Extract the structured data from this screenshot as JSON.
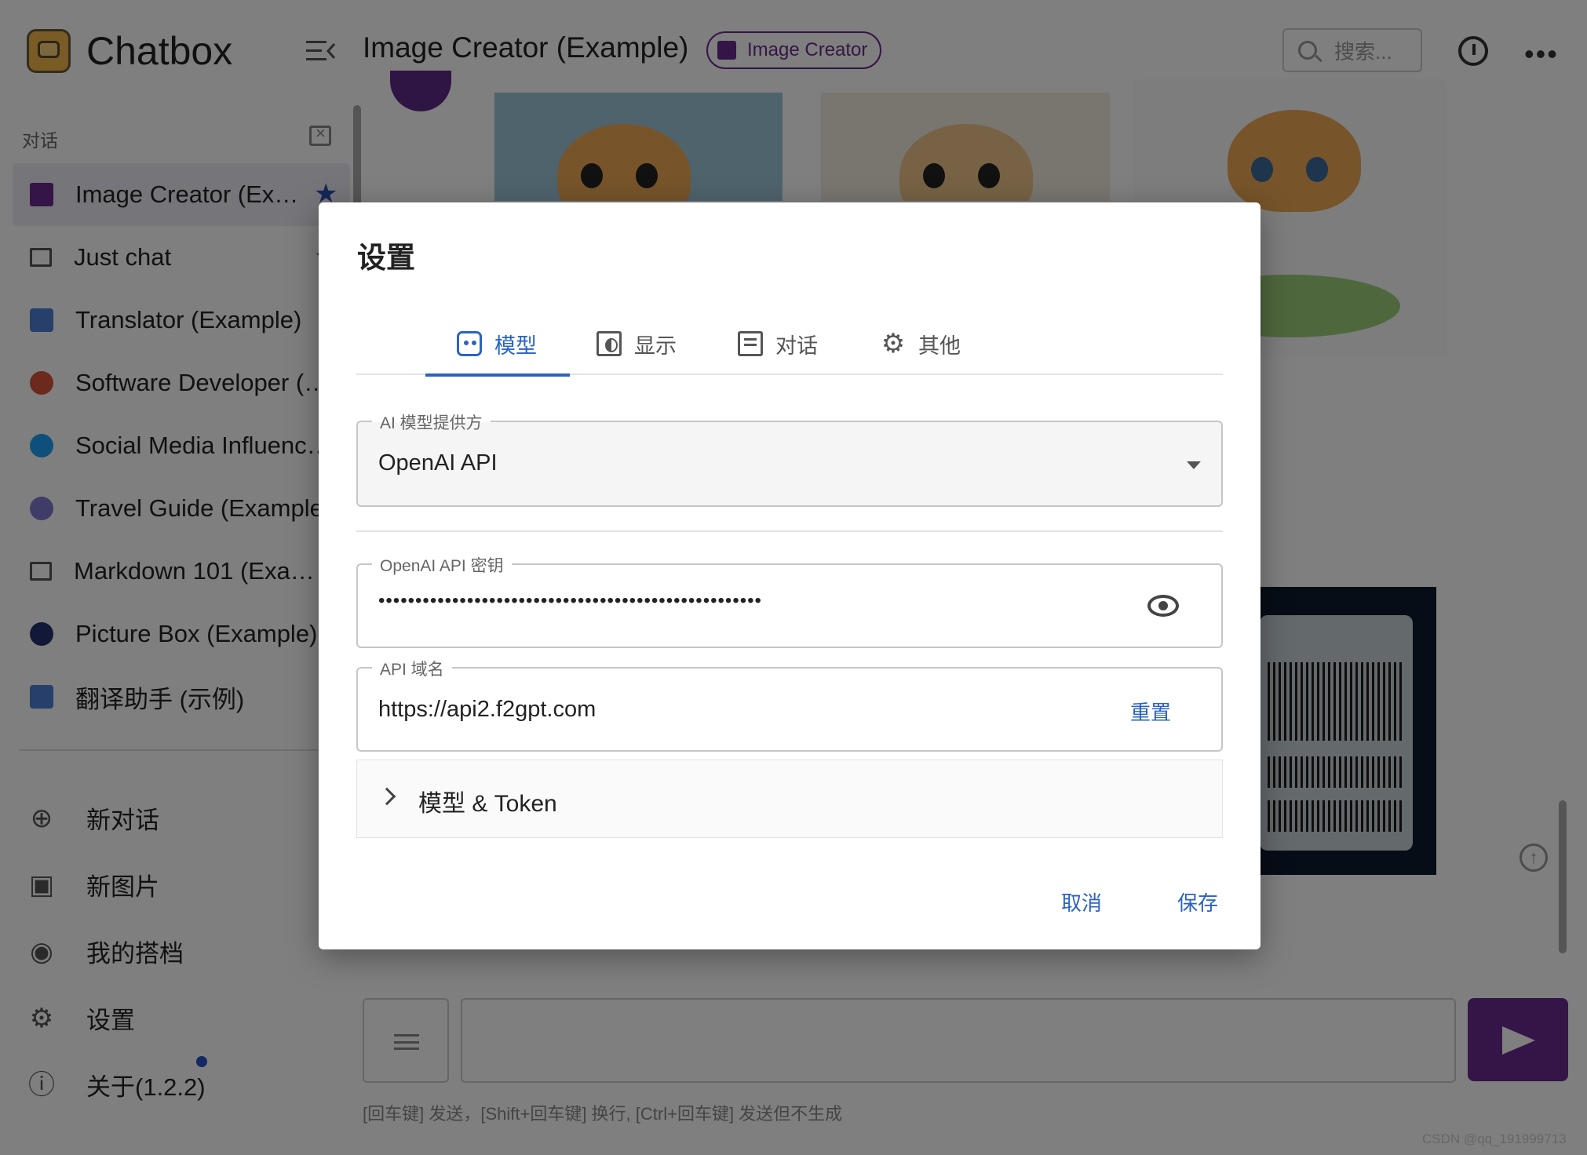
{
  "app": {
    "name": "Chatbox",
    "colors": {
      "accent": "#6b2a8e",
      "primary": "#2a63c6"
    }
  },
  "sidebar": {
    "section_label": "对话",
    "conversations": [
      {
        "label": "Image Creator (Ex…",
        "icon": "image-icon",
        "starred": true,
        "active": true
      },
      {
        "label": "Just chat",
        "icon": "chat-bubble-icon",
        "starred": true,
        "active": false
      },
      {
        "label": "Translator (Example)",
        "icon": "translator-avatar-icon",
        "starred": false,
        "active": false
      },
      {
        "label": "Software Developer (…",
        "icon": "developer-avatar-icon",
        "starred": false,
        "active": false
      },
      {
        "label": "Social Media Influenc…",
        "icon": "twitter-avatar-icon",
        "starred": false,
        "active": false
      },
      {
        "label": "Travel Guide (Example)",
        "icon": "travel-avatar-icon",
        "starred": false,
        "active": false
      },
      {
        "label": "Markdown 101 (Exa…",
        "icon": "chat-bubble-icon",
        "starred": false,
        "active": false
      },
      {
        "label": "Picture Box (Example)",
        "icon": "picture-avatar-icon",
        "starred": false,
        "active": false
      },
      {
        "label": "翻译助手 (示例)",
        "icon": "translator-avatar-icon",
        "starred": false,
        "active": false
      }
    ],
    "actions": [
      {
        "label": "新对话",
        "icon": "plus-circle-icon"
      },
      {
        "label": "新图片",
        "icon": "add-image-icon"
      },
      {
        "label": "我的搭档",
        "icon": "robot-icon"
      },
      {
        "label": "设置",
        "icon": "gear-icon"
      },
      {
        "label": "关于(1.2.2)",
        "icon": "info-icon"
      }
    ]
  },
  "header": {
    "title": "Image Creator (Example)",
    "chip": "Image Creator",
    "search_placeholder": "搜索..."
  },
  "composer": {
    "hint": "[回车键] 发送，[Shift+回车键] 换行, [Ctrl+回车键] 发送但不生成"
  },
  "watermark": "CSDN @qq_191999713",
  "dialog": {
    "title": "设置",
    "tabs": [
      {
        "label": "模型",
        "icon": "robot-icon",
        "active": true
      },
      {
        "label": "显示",
        "icon": "display-icon",
        "active": false
      },
      {
        "label": "对话",
        "icon": "chat-icon",
        "active": false
      },
      {
        "label": "其他",
        "icon": "gear-icon",
        "active": false
      }
    ],
    "provider": {
      "label": "AI 模型提供方",
      "value": "OpenAI API"
    },
    "api_key": {
      "label": "OpenAI API 密钥",
      "value": "••••••••••••••••••••••••••••••••••••••••••••••••••••"
    },
    "api_host": {
      "label": "API 域名",
      "value": "https://api2.f2gpt.com",
      "reset_label": "重置"
    },
    "accordion_label": "模型 & Token",
    "cancel_label": "取消",
    "save_label": "保存"
  }
}
